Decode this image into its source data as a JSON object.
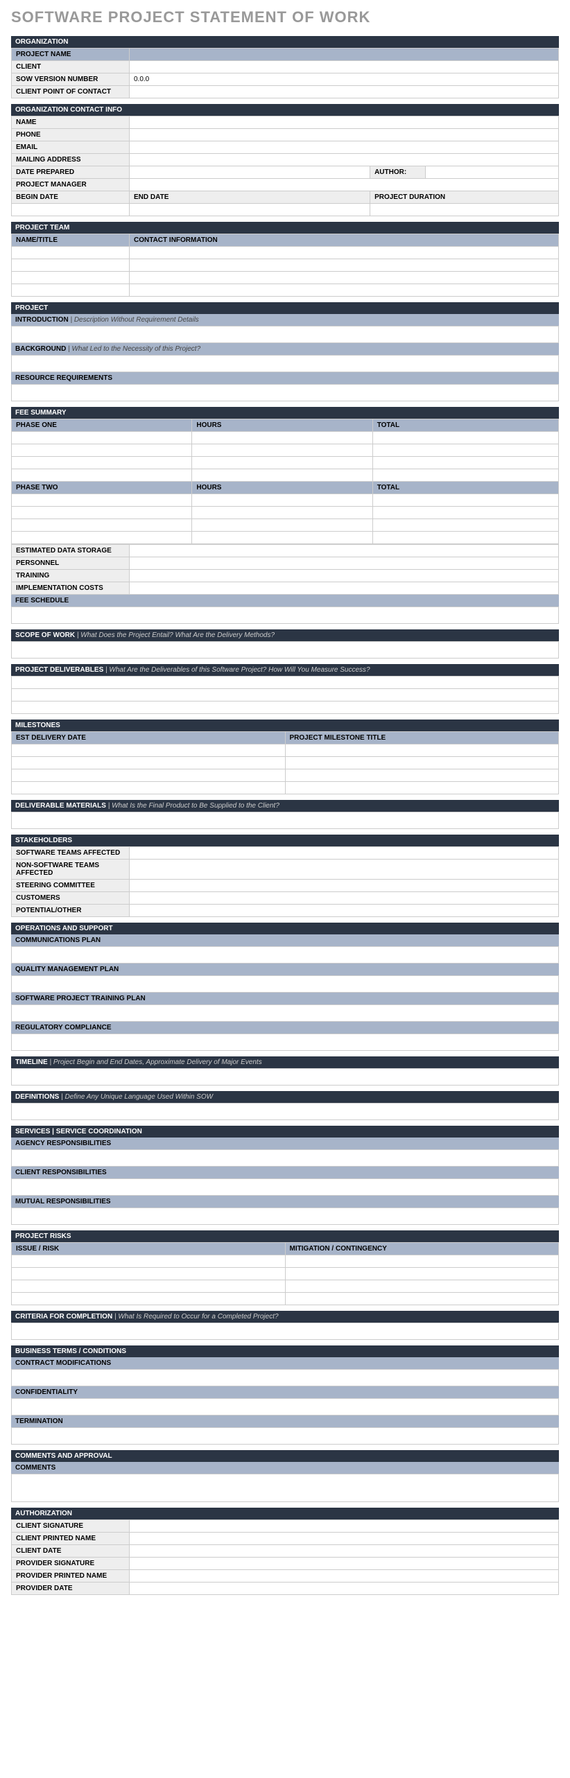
{
  "title": "SOFTWARE PROJECT STATEMENT OF WORK",
  "org": {
    "header": "ORGANIZATION",
    "projectName": "PROJECT NAME",
    "client": "CLIENT",
    "sowVersion": "SOW VERSION NUMBER",
    "sowVersionVal": "0.0.0",
    "poc": "CLIENT POINT OF CONTACT"
  },
  "contact": {
    "header": "ORGANIZATION CONTACT INFO",
    "name": "NAME",
    "phone": "PHONE",
    "email": "EMAIL",
    "mailing": "MAILING ADDRESS",
    "datePrepared": "DATE PREPARED",
    "author": "AUTHOR:",
    "pm": "PROJECT MANAGER",
    "beginDate": "BEGIN DATE",
    "endDate": "END DATE",
    "duration": "PROJECT DURATION"
  },
  "team": {
    "header": "PROJECT TEAM",
    "col1": "NAME/TITLE",
    "col2": "CONTACT INFORMATION"
  },
  "project": {
    "header": "PROJECT",
    "intro": "INTRODUCTION",
    "introHint": " |  Description Without Requirement Details",
    "background": "BACKGROUND",
    "backgroundHint": " |  What Led to the Necessity of this Project?",
    "resource": "RESOURCE REQUIREMENTS"
  },
  "fee": {
    "header": "FEE SUMMARY",
    "phase1": "PHASE ONE",
    "phase2": "PHASE TWO",
    "hours": "HOURS",
    "total": "TOTAL",
    "storage": "ESTIMATED DATA STORAGE",
    "personnel": "PERSONNEL",
    "training": "TRAINING",
    "impl": "IMPLEMENTATION COSTS",
    "schedule": "FEE SCHEDULE"
  },
  "scope": {
    "header": "SCOPE OF WORK",
    "hint": "  |  What Does the Project Entail? What Are the Delivery Methods?"
  },
  "deliverables": {
    "header": "PROJECT DELIVERABLES",
    "hint": " |  What Are the Deliverables of this Software Project? How Will You Measure Success?"
  },
  "milestones": {
    "header": "MILESTONES",
    "col1": "EST DELIVERY DATE",
    "col2": "PROJECT MILESTONE TITLE"
  },
  "delivMat": {
    "header": "DELIVERABLE MATERIALS",
    "hint": " |  What Is the Final Product to Be Supplied to the Client?"
  },
  "stakeholders": {
    "header": "STAKEHOLDERS",
    "sw": "SOFTWARE TEAMS AFFECTED",
    "nonsw": "NON-SOFTWARE TEAMS AFFECTED",
    "steering": "STEERING COMMITTEE",
    "customers": "CUSTOMERS",
    "other": "POTENTIAL/OTHER"
  },
  "ops": {
    "header": "OPERATIONS AND SUPPORT",
    "comm": "COMMUNICATIONS PLAN",
    "quality": "QUALITY MANAGEMENT PLAN",
    "training": "SOFTWARE PROJECT TRAINING PLAN",
    "reg": "REGULATORY COMPLIANCE"
  },
  "timeline": {
    "header": "TIMELINE",
    "hint": " |  Project Begin and End Dates, Approximate Delivery of Major Events"
  },
  "definitions": {
    "header": "DEFINITIONS",
    "hint": " |  Define Any Unique Language Used Within SOW"
  },
  "services": {
    "header": "SERVICES | SERVICE COORDINATION",
    "agency": "AGENCY RESPONSIBILITIES",
    "client": "CLIENT RESPONSIBILITIES",
    "mutual": "MUTUAL RESPONSIBILITIES"
  },
  "risks": {
    "header": "PROJECT RISKS",
    "col1": "ISSUE / RISK",
    "col2": "MITIGATION / CONTINGENCY"
  },
  "completion": {
    "header": "CRITERIA FOR COMPLETION",
    "hint": " |  What Is Required to Occur for a Completed Project?"
  },
  "terms": {
    "header": "BUSINESS TERMS / CONDITIONS",
    "mods": "CONTRACT MODIFICATIONS",
    "conf": "CONFIDENTIALITY",
    "term": "TERMINATION"
  },
  "comments": {
    "header": "COMMENTS AND APPROVAL",
    "label": "COMMENTS"
  },
  "auth": {
    "header": "AUTHORIZATION",
    "clientSig": "CLIENT SIGNATURE",
    "clientName": "CLIENT PRINTED NAME",
    "clientDate": "CLIENT DATE",
    "provSig": "PROVIDER SIGNATURE",
    "provName": "PROVIDER PRINTED NAME",
    "provDate": "PROVIDER DATE"
  }
}
